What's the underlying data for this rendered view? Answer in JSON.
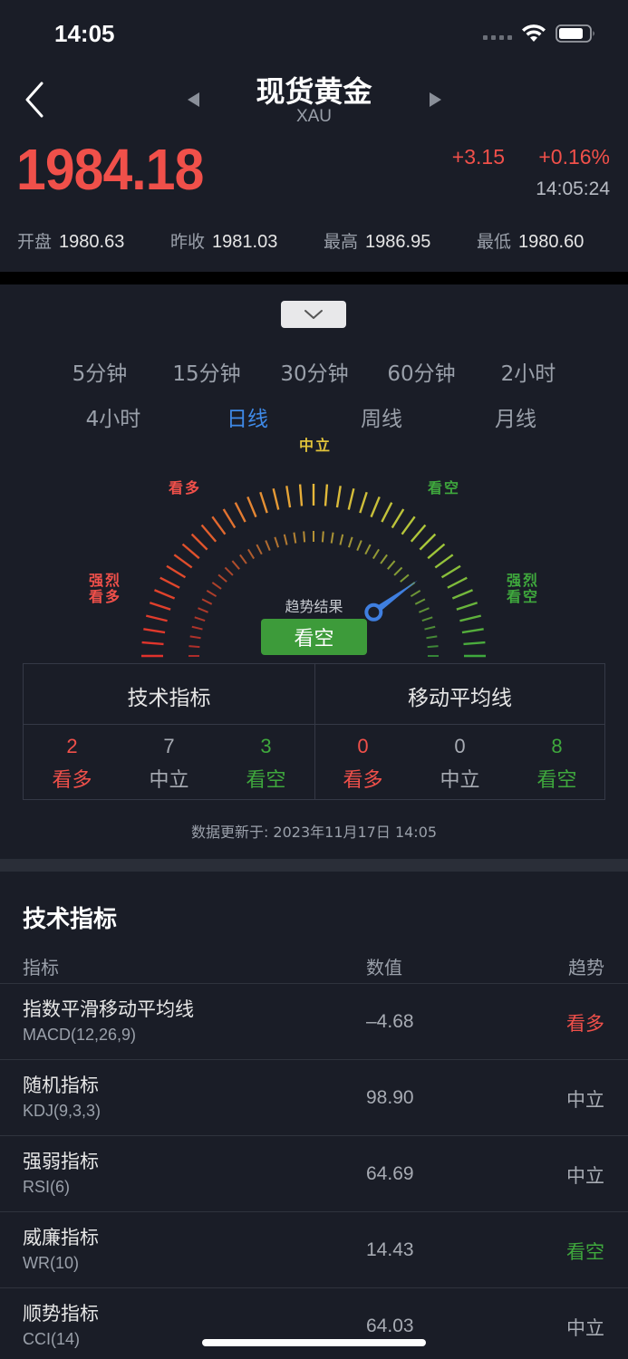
{
  "status_bar": {
    "time": "14:05"
  },
  "header": {
    "title": "现货黄金",
    "symbol": "XAU"
  },
  "quote": {
    "price": "1984.18",
    "change": "+3.15",
    "change_pct": "+0.16%",
    "time": "14:05:24",
    "price_color": "#f0504a"
  },
  "ohlc": [
    {
      "label": "开盘",
      "value": "1980.63"
    },
    {
      "label": "昨收",
      "value": "1981.03"
    },
    {
      "label": "最高",
      "value": "1986.95"
    },
    {
      "label": "最低",
      "value": "1980.60"
    }
  ],
  "periods": {
    "row1": [
      "5分钟",
      "15分钟",
      "30分钟",
      "60分钟",
      "2小时"
    ],
    "row2": [
      "4小时",
      "日线",
      "周线",
      "月线"
    ],
    "active": "日线",
    "active_color": "#3f8ae8"
  },
  "gauge": {
    "labels": {
      "strong_buy": "强烈\n看多",
      "buy": "看多",
      "neutral": "中立",
      "sell": "看空",
      "strong_sell": "强烈\n看空"
    },
    "caption": "趋势结果",
    "result": "看空",
    "result_color": "#3d9b3a",
    "needle_position": 0.8
  },
  "summary": {
    "technical": {
      "title": "技术指标",
      "cells": [
        {
          "count": "2",
          "label": "看多"
        },
        {
          "count": "7",
          "label": "中立"
        },
        {
          "count": "3",
          "label": "看空"
        }
      ]
    },
    "moving_average": {
      "title": "移动平均线",
      "cells": [
        {
          "count": "0",
          "label": "看多"
        },
        {
          "count": "0",
          "label": "中立"
        },
        {
          "count": "8",
          "label": "看空"
        }
      ]
    }
  },
  "updated_text": "数据更新于: 2023年11月17日 14:05",
  "technical_indicators": {
    "title": "技术指标",
    "columns": [
      "指标",
      "数值",
      "趋势"
    ],
    "rows": [
      {
        "name": "指数平滑移动平均线",
        "code": "MACD(12,26,9)",
        "value": "–4.68",
        "trend": "看多",
        "tone": "red"
      },
      {
        "name": "随机指标",
        "code": "KDJ(9,3,3)",
        "value": "98.90",
        "trend": "中立",
        "tone": "gray"
      },
      {
        "name": "强弱指标",
        "code": "RSI(6)",
        "value": "64.69",
        "trend": "中立",
        "tone": "gray"
      },
      {
        "name": "威廉指标",
        "code": "WR(10)",
        "value": "14.43",
        "trend": "看空",
        "tone": "green"
      },
      {
        "name": "顺势指标",
        "code": "CCI(14)",
        "value": "64.03",
        "trend": "中立",
        "tone": "gray"
      }
    ]
  },
  "colors": {
    "bull": "#f0504a",
    "neutral": "#a7abb3",
    "bear": "#3fa83d"
  }
}
